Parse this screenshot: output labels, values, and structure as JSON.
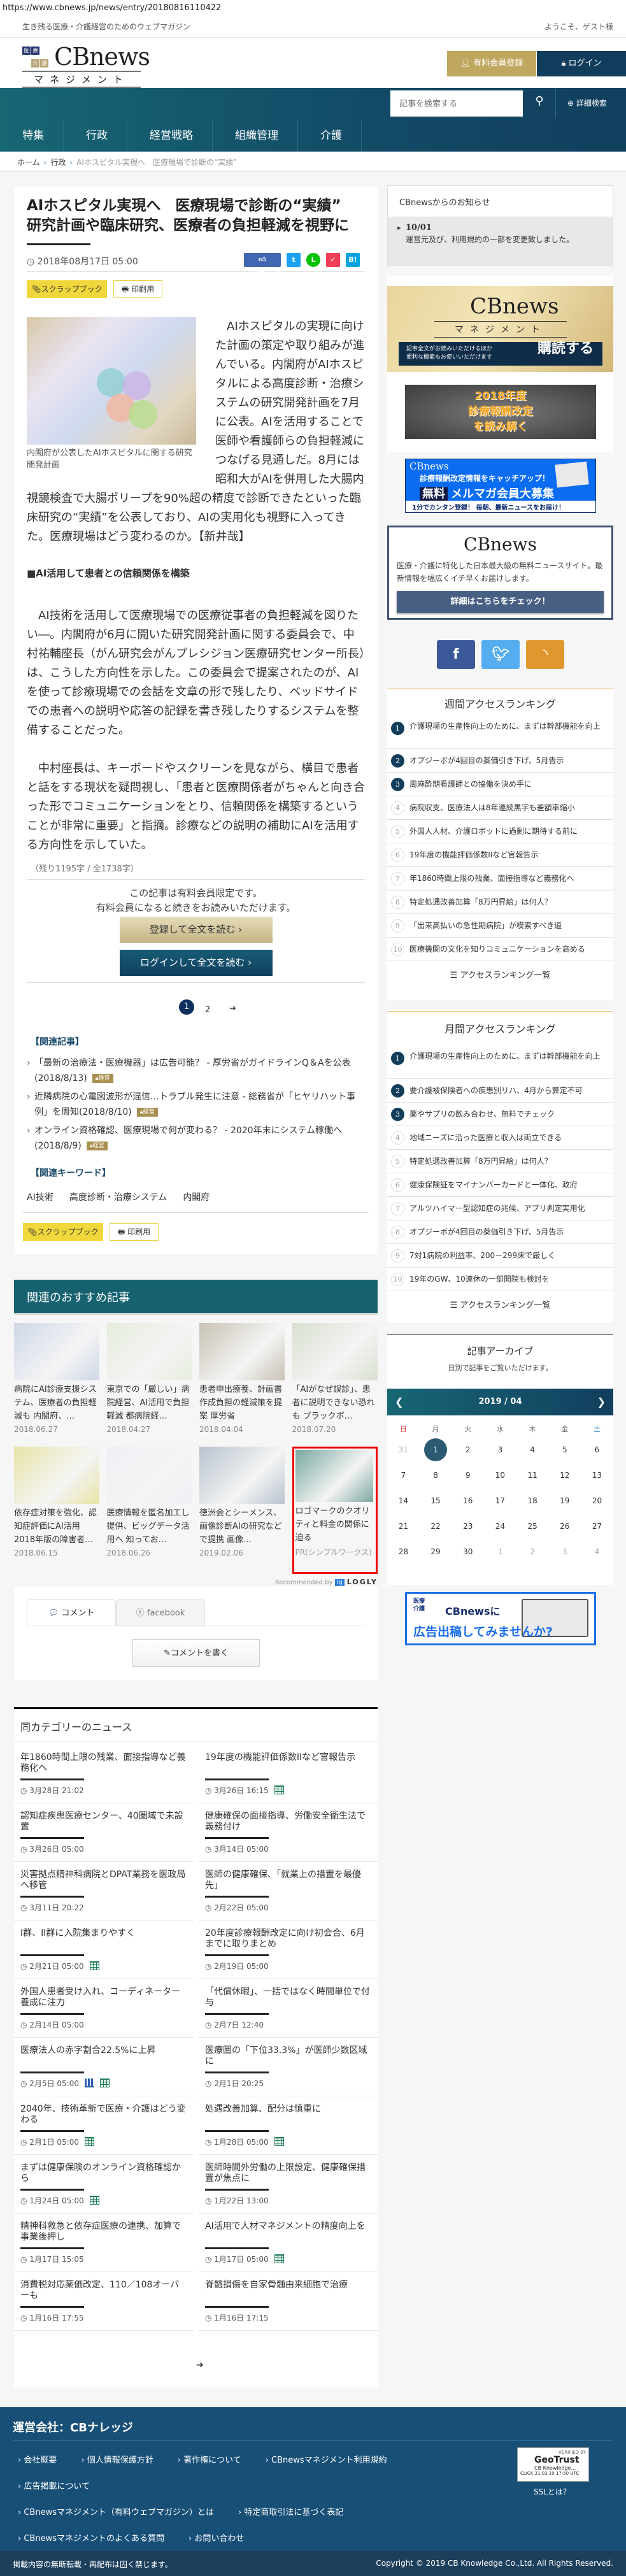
{
  "url": "https://www.cbnews.jp/news/entry/20180816110422",
  "topbar": {
    "tagline": "生き残る医療・介護経営のためのウェブマガジン",
    "welcome": "ようこそ、ゲスト様"
  },
  "logo": {
    "boxes": [
      "医",
      "療",
      "介",
      "護"
    ],
    "name": "CBnews",
    "sub": "マネジメント"
  },
  "header": {
    "register_label": "有料会員登録",
    "login_label": "ログイン"
  },
  "search": {
    "placeholder": "記事を検索する",
    "advanced_label": "詳細検索"
  },
  "nav": [
    "特集",
    "行政",
    "経営戦略",
    "組織管理",
    "介護"
  ],
  "breadcrumb": {
    "home": "ホーム",
    "category": "行政",
    "current": "AIホスピタル実現へ　医療現場で診断の“実績”"
  },
  "article": {
    "title_line1": "AIホスピタル実現へ　医療現場で診断の“実績”",
    "title_line2": "研究計画や臨床研究、医療者の負担軽減を視野に",
    "date": "2018年08月17日 05:00",
    "like_label": "いいね！ 2",
    "scrapbook_label": "スクラップブック",
    "print_label": "印刷用",
    "image_caption": "内閣府が公表したAIホスピタルに関する研究開発計画",
    "para1": "　AIホスピタルの実現に向けた計画の策定や取り組みが進んでいる。内閣府がAIホスピタルによる高度診断・治療システムの研究開発計画を7月に公表。AIを活用することで医師や看護師らの負担軽減につなげる見通しだ。8月には昭和大がAIを併用した大腸内視鏡検査で大腸ポリープを90%超の精度で診断できたといった臨床研究の“実績”を公表しており、AIの実用化も視野に入ってきた。医療現場はどう変わるのか。【新井哉】",
    "heading": "■AI活用して患者との信頼関係を構築",
    "para2": "　AI技術を活用して医療現場での医療従事者の負担軽減を図りたい―。内閣府が6月に開いた研究開発計画に関する委員会で、中村祐輔座長（がん研究会がんプレシジョン医療研究センター所長）は、こうした方向性を示した。この委員会で提案されたのが、AIを使って診療現場での会話を文章の形で残したり、ベッドサイドでの患者への説明や応答の記録を書き残したりするシステムを整備することだった。",
    "para3": "　中村座長は、キーボードやスクリーンを見ながら、横目で患者と話をする現状を疑問視し、「患者と医療関係者がちゃんと向き合った形でコミュニケーションをとり、信頼関係を構築するということが非常に重要」と指摘。診療などの説明の補助にAIを活用する方向性を示していた。",
    "remaining": "（残り1195字 / 全1738字）",
    "paywall_line1": "この記事は有料会員限定です。",
    "paywall_line2": "有料会員になると続きをお読みいただけます。",
    "register_read": "登録して全文を読む ›",
    "login_read": "ログインして全文を読む ›",
    "pages": [
      "1",
      "2"
    ],
    "current_page": "1",
    "related_heading": "【関連記事】",
    "related": [
      {
        "text": "「最新の治療法・医療機器」は広告可能？ - 厚労省がガイドラインQ＆Aを公表(2018/8/13)",
        "badge": "経営"
      },
      {
        "text": "近隣病院の心電図波形が混信…トラブル発生に注意 - 総務省が「ヒヤリハット事例」を周知(2018/8/10)",
        "badge": "経営"
      },
      {
        "text": "オンライン資格確認、医療現場で何が変わる？ - 2020年末にシステム稼働へ(2018/8/9)",
        "badge": "経営"
      }
    ],
    "keywords_heading": "【関連キーワード】",
    "keywords": [
      "AI技術",
      "高度診断・治療システム",
      "内閣府"
    ]
  },
  "recommended": {
    "heading": "関連のおすすめ記事",
    "items": [
      {
        "title": "病院にAI診療支援システム、医療者の負担軽減も 内閣府、…",
        "date": "2018.06.27"
      },
      {
        "title": "東京での「厳しい」病院経営、AI活用で負担軽減 都病院経…",
        "date": "2018.04.27"
      },
      {
        "title": "患者申出療養、計画書作成負担の軽減策を提案 厚労省",
        "date": "2018.04.04"
      },
      {
        "title": "「AIがなぜ誤診」、患者に説明できない恐れも ブラックボ…",
        "date": "2018.07.20"
      },
      {
        "title": "依存症対策を強化、認知症評価にAI活用 2018年版の障害者…",
        "date": "2018.06.15"
      },
      {
        "title": "医療情報を匿名加工し提供、ビッグデータ活用へ 知ってお…",
        "date": "2018.06.26"
      },
      {
        "title": "徳洲会とシーメンス、画像診断AIの研究などで提携 画像…",
        "date": "2019.02.06"
      },
      {
        "title": "ロゴマークのクオリティと料金の関係に迫る",
        "date": "PR(シンプルワークス)"
      }
    ],
    "recommended_by": "Recommended by",
    "logly": "LOGLY"
  },
  "comments": {
    "tab_comment": "コメント",
    "tab_facebook": "facebook",
    "write_label": "コメントを書く"
  },
  "category_news": {
    "heading": "同カテゴリーのニュース",
    "left": [
      {
        "title": "年1860時間上限の残業、面接指導など義務化へ",
        "date": "3月28日 21:02",
        "icons": []
      },
      {
        "title": "認知症疾患医療センター、40圏域で未設置",
        "date": "3月26日 05:00",
        "icons": []
      },
      {
        "title": "災害拠点精神科病院とDPAT業務を医政局へ移管",
        "date": "3月11日 20:22",
        "icons": []
      },
      {
        "title": "I群、II群に入院集まりやすく",
        "date": "2月21日 05:00",
        "icons": [
          "table"
        ]
      },
      {
        "title": "外国人患者受け入れ、コーディネーター養成に注力",
        "date": "2月14日 05:00",
        "icons": []
      },
      {
        "title": "医療法人の赤字割合22.5%に上昇",
        "date": "2月5日 05:00",
        "icons": [
          "chart",
          "table"
        ]
      },
      {
        "title": "2040年、技術革新で医療・介護はどう変わる",
        "date": "2月1日 05:00",
        "icons": [
          "table"
        ]
      },
      {
        "title": "まずは健康保険のオンライン資格確認から",
        "date": "1月24日 05:00",
        "icons": [
          "table"
        ]
      },
      {
        "title": "精神科救急と依存症医療の連携、加算で事業後押し",
        "date": "1月17日 15:05",
        "icons": []
      },
      {
        "title": "消費税対応薬価改定、110／108オーバーも",
        "date": "1月16日 17:55",
        "icons": []
      }
    ],
    "right": [
      {
        "title": "19年度の機能評価係数IIなど官報告示",
        "date": "3月26日 16:15",
        "icons": [
          "table"
        ]
      },
      {
        "title": "健康確保の面接指導、労働安全衛生法で義務付け",
        "date": "3月14日 05:00",
        "icons": []
      },
      {
        "title": "医師の健康確保、「就業上の措置を最優先」",
        "date": "2月22日 05:00",
        "icons": []
      },
      {
        "title": "20年度診療報酬改定に向け初会合、6月までに取りまとめ",
        "date": "2月19日 05:00",
        "icons": []
      },
      {
        "title": "「代償休暇」、一括ではなく時間単位で付与",
        "date": "2月7日 12:40",
        "icons": []
      },
      {
        "title": "医療圏の「下位33.3%」が医師少数区域に",
        "date": "2月1日 20:25",
        "icons": []
      },
      {
        "title": "処遇改善加算、配分は慎重に",
        "date": "1月28日 05:00",
        "icons": [
          "table"
        ]
      },
      {
        "title": "医師時間外労働の上限設定、健康確保措置が焦点に",
        "date": "1月22日 13:00",
        "icons": []
      },
      {
        "title": "AI活用で人材マネジメントの精度向上を",
        "date": "1月17日 05:00",
        "icons": [
          "table"
        ]
      },
      {
        "title": "脊髄損傷を自家骨髄由来細胞で治療",
        "date": "1月16日 17:15",
        "icons": []
      }
    ]
  },
  "sidebar": {
    "notice": {
      "heading": "CBnewsからのお知らせ",
      "date": "10/01",
      "text": "運営元及び、利用規約の一部を変更致しました。"
    },
    "subscribe": {
      "line1": "記事全文がお読みいただけるほか",
      "line2": "便利な機能もお使いいただけます",
      "cta": "購読する"
    },
    "banner2018": {
      "line1": "2018年度",
      "line2": "診療報酬改定",
      "line3": "を読み解く"
    },
    "mailmag": {
      "brand": "CBnews",
      "line1": "診療報酬改定情報をキャッチアップ！",
      "badge": "無料",
      "line2": "メルマガ会員大募集",
      "line3": "1分でカンタン登録！ 毎朝、最新ニュースをお届け！"
    },
    "cbbox": {
      "logo": "CBnews",
      "text": "医療・介護に特化した日本最大級の無料ニュースサイト。最新情報を幅広くイチ早くお届けします。",
      "button": "詳細はこちらをチェック！"
    },
    "social": {
      "facebook": "f",
      "twitter": "t",
      "rss": "rss"
    },
    "weekly": {
      "heading": "週間アクセスランキング",
      "items": [
        "介護現場の生産性向上のために、まずは幹部機能を向上",
        "オプジーボが4回目の薬価引き下げ、5月告示",
        "周麻酔期看護師との協働を決め手に",
        "病院収支、医療法人は8年連続黒字も差額率縮小",
        "外国人人材、介護ロボットに過剰に期待する前に",
        "19年度の機能評価係数IIなど官報告示",
        "年1860時間上限の残業、面接指導など義務化へ",
        "特定処遇改善加算「8万円昇給」は何人？",
        "「出来高払いの急性期病院」が模索すべき道",
        "医療機関の文化を知りコミュニケーションを高める"
      ],
      "more": "アクセスランキング一覧"
    },
    "monthly": {
      "heading": "月間アクセスランキング",
      "items": [
        "介護現場の生産性向上のために、まずは幹部機能を向上",
        "要介護被保険者への疾患別リハ、4月から算定不可",
        "薬やサプリの飲み合わせ、無料でチェック",
        "地域ニーズに沿った医療と収入は両立できる",
        "特定処遇改善加算「8万円昇給」は何人？",
        "健康保険証をマイナンバーカードと一体化、政府",
        "アルツハイマー型認知症の兆候、アプリ判定実用化",
        "オプジーボが4回目の薬価引き下げ、5月告示",
        "7対1病院の利益率、200－299床で厳しく",
        "19年のGW、10連休の一部開院も検討を"
      ],
      "more": "アクセスランキング一覧"
    },
    "archive": {
      "heading": "記事アーカイブ",
      "sub": "日別で記事をご覧いただけます。",
      "month": "2019 / 04",
      "weekdays": [
        "日",
        "月",
        "火",
        "水",
        "木",
        "金",
        "土"
      ],
      "selected": "1",
      "weeks": [
        [
          [
            "31",
            1
          ],
          [
            "1",
            0
          ],
          [
            "2",
            0
          ],
          [
            "3",
            0
          ],
          [
            "4",
            0
          ],
          [
            "5",
            0
          ],
          [
            "6",
            0
          ]
        ],
        [
          [
            "7",
            0
          ],
          [
            "8",
            0
          ],
          [
            "9",
            0
          ],
          [
            "10",
            0
          ],
          [
            "11",
            0
          ],
          [
            "12",
            0
          ],
          [
            "13",
            0
          ]
        ],
        [
          [
            "14",
            0
          ],
          [
            "15",
            0
          ],
          [
            "16",
            0
          ],
          [
            "17",
            0
          ],
          [
            "18",
            0
          ],
          [
            "19",
            0
          ],
          [
            "20",
            0
          ]
        ],
        [
          [
            "21",
            0
          ],
          [
            "22",
            0
          ],
          [
            "23",
            0
          ],
          [
            "24",
            0
          ],
          [
            "25",
            0
          ],
          [
            "26",
            0
          ],
          [
            "27",
            0
          ]
        ],
        [
          [
            "28",
            0
          ],
          [
            "29",
            0
          ],
          [
            "30",
            0
          ],
          [
            "1",
            1
          ],
          [
            "2",
            1
          ],
          [
            "3",
            1
          ],
          [
            "4",
            1
          ]
        ]
      ]
    },
    "ad": {
      "badge": "医療\n介護",
      "line1": "CBnewsに",
      "line2": "広告出稿してみませんか?"
    }
  },
  "footer": {
    "company": "運営会社：CBナレッジ",
    "links": [
      [
        "会社概要",
        "個人情報保護方針",
        "著作権について",
        "CBnewsマネジメント利用規約"
      ],
      [
        "広告掲載について"
      ],
      [
        "CBnewsマネジメント（有料ウェブマガジン）とは",
        "特定商取引法に基づく表記"
      ],
      [
        "CBnewsマネジメントのよくある質問",
        "お問い合わせ"
      ]
    ],
    "geotrust": {
      "verified": "VERIFIED BY",
      "brand": "GeoTrust",
      "org": "CB Knowledge...",
      "stamp": "CLICK 31.03.19 17:50 UTC"
    },
    "ssl": "SSLとは？",
    "notice": "掲載内容の無断転載・再配布は固く禁じます。",
    "copyright": "Copyright © 2019 CB Knowledge Co.,Ltd. All Rights Reserved."
  },
  "colors": {
    "nav": "#176674",
    "gold": "#bfa760",
    "navy": "#123c5c",
    "footer": "#184f77",
    "scrap": "#f0d83c"
  }
}
